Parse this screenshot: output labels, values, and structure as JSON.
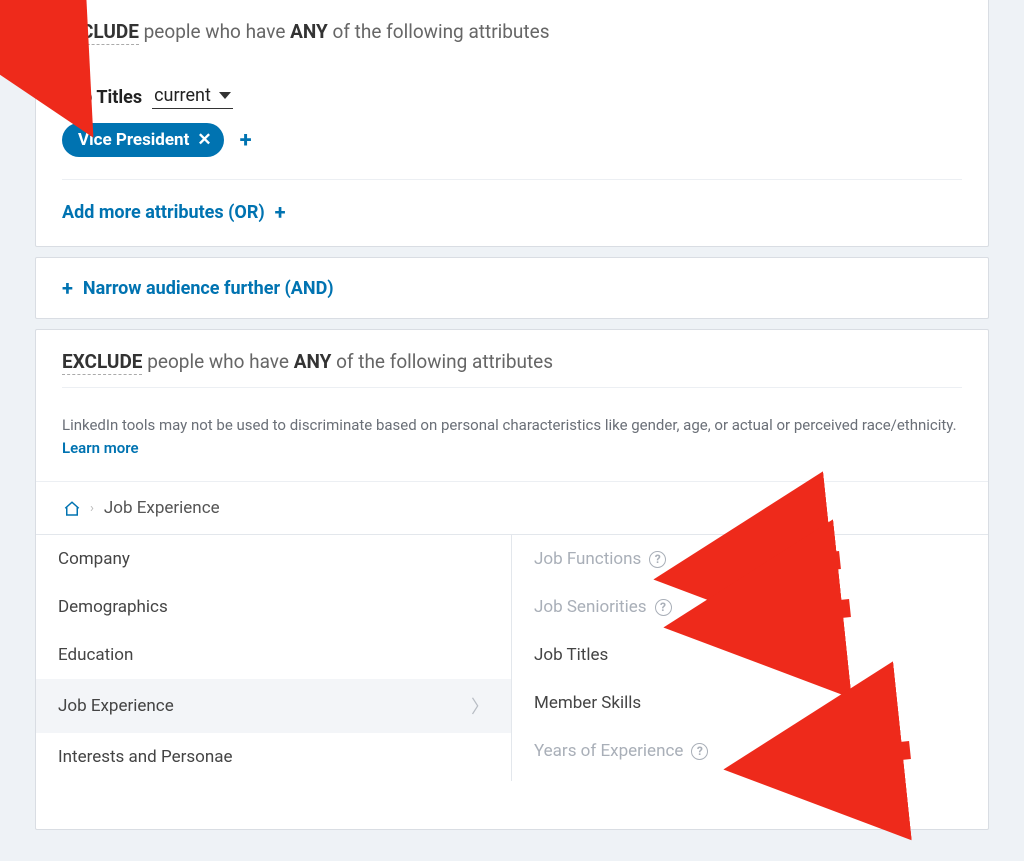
{
  "include": {
    "header_prefix": "INCLUDE",
    "header_mid": " people who have ",
    "header_any": "ANY",
    "header_suffix": " of the following attributes",
    "field_label": "Job Titles",
    "scope_value": "current",
    "chip_label": "Vice President",
    "chip_close": "✕",
    "add_chip_plus": "+",
    "add_more_label": "Add more attributes (OR)",
    "add_more_plus": "+"
  },
  "narrow": {
    "plus": "+",
    "label": "Narrow audience further (AND)"
  },
  "exclude": {
    "header_prefix": "EXCLUDE",
    "header_mid": " people who have ",
    "header_any": "ANY",
    "header_suffix": " of the following attributes",
    "disclaimer_text": "LinkedIn tools may not be used to discriminate based on personal characteristics like gender, age, or actual or perceived race/ethnicity. ",
    "learn_more": "Learn more",
    "breadcrumb_current": "Job Experience",
    "categories": [
      {
        "label": "Company",
        "selected": false
      },
      {
        "label": "Demographics",
        "selected": false
      },
      {
        "label": "Education",
        "selected": false
      },
      {
        "label": "Job Experience",
        "selected": true
      },
      {
        "label": "Interests and Personae",
        "selected": false
      }
    ],
    "sub_items": [
      {
        "label": "Job Functions",
        "disabled": true,
        "help": true
      },
      {
        "label": "Job Seniorities",
        "disabled": true,
        "help": true
      },
      {
        "label": "Job Titles",
        "disabled": false,
        "help": false
      },
      {
        "label": "Member Skills",
        "disabled": false,
        "help": false
      },
      {
        "label": "Years of Experience",
        "disabled": true,
        "help": true
      }
    ],
    "help_glyph": "?"
  }
}
